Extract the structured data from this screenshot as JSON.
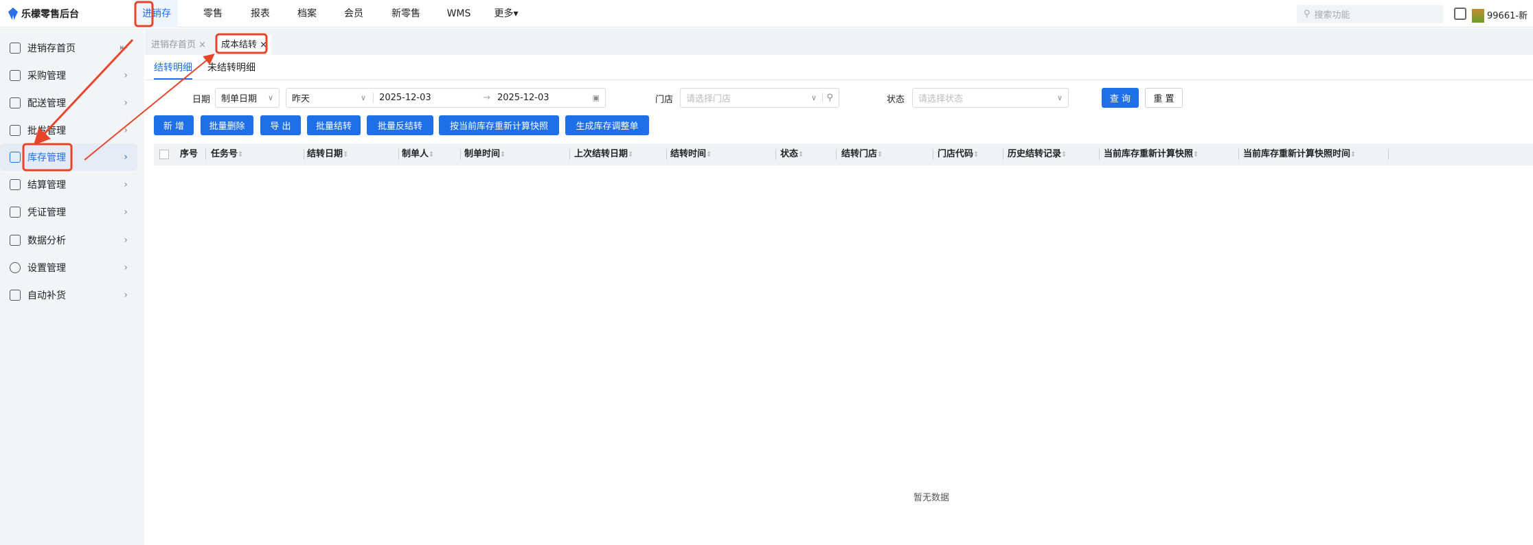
{
  "app": {
    "title": "乐檬零售后台"
  },
  "nav": {
    "items": [
      {
        "label": "进销存",
        "active": true
      },
      {
        "label": "零售"
      },
      {
        "label": "报表"
      },
      {
        "label": "档案"
      },
      {
        "label": "会员"
      },
      {
        "label": "新零售"
      },
      {
        "label": "WMS"
      },
      {
        "label": "更多▾"
      }
    ]
  },
  "search": {
    "placeholder": "搜索功能"
  },
  "user": {
    "name": "99661-新"
  },
  "sidebar": {
    "collapse_icon": "collapse-icon",
    "items": [
      {
        "label": "进销存首页",
        "icon": "home-icon"
      },
      {
        "label": "采购管理",
        "icon": "cart-icon"
      },
      {
        "label": "配送管理",
        "icon": "delivery-icon"
      },
      {
        "label": "批发管理",
        "icon": "wholesale-icon"
      },
      {
        "label": "库存管理",
        "icon": "inventory-icon",
        "active": true
      },
      {
        "label": "结算管理",
        "icon": "dollar-icon"
      },
      {
        "label": "凭证管理",
        "icon": "voucher-icon"
      },
      {
        "label": "数据分析",
        "icon": "chart-icon"
      },
      {
        "label": "设置管理",
        "icon": "settings-icon"
      },
      {
        "label": "自动补货",
        "icon": "replenish-icon"
      }
    ]
  },
  "tabs": [
    {
      "label": "进销存首页"
    },
    {
      "label": "成本结转",
      "active": true
    }
  ],
  "subtabs": [
    {
      "label": "结转明细",
      "active": true
    },
    {
      "label": "未结转明细"
    }
  ],
  "filters": {
    "date_label": "日期",
    "date_type": "制单日期",
    "date_preset": "昨天",
    "date_start": "2025-12-03",
    "date_sep": "→",
    "date_end": "2025-12-03",
    "store_label": "门店",
    "store_placeholder": "请选择门店",
    "status_label": "状态",
    "status_placeholder": "请选择状态",
    "query": "查 询",
    "reset": "重 置"
  },
  "actions": [
    "新 增",
    "批量删除",
    "导 出",
    "批量结转",
    "批量反结转",
    "按当前库存重新计算快照",
    "生成库存调整单"
  ],
  "table": {
    "columns": [
      "序号",
      "任务号",
      "结转日期",
      "制单人",
      "制单时间",
      "上次结转日期",
      "结转时间",
      "状态",
      "结转门店",
      "门店代码",
      "历史结转记录",
      "当前库存重新计算快照",
      "当前库存重新计算快照时间"
    ],
    "rows": [],
    "empty_text": "暂无数据"
  },
  "colors": {
    "accent": "#1f6fe8",
    "annotation": "#e8442a"
  }
}
